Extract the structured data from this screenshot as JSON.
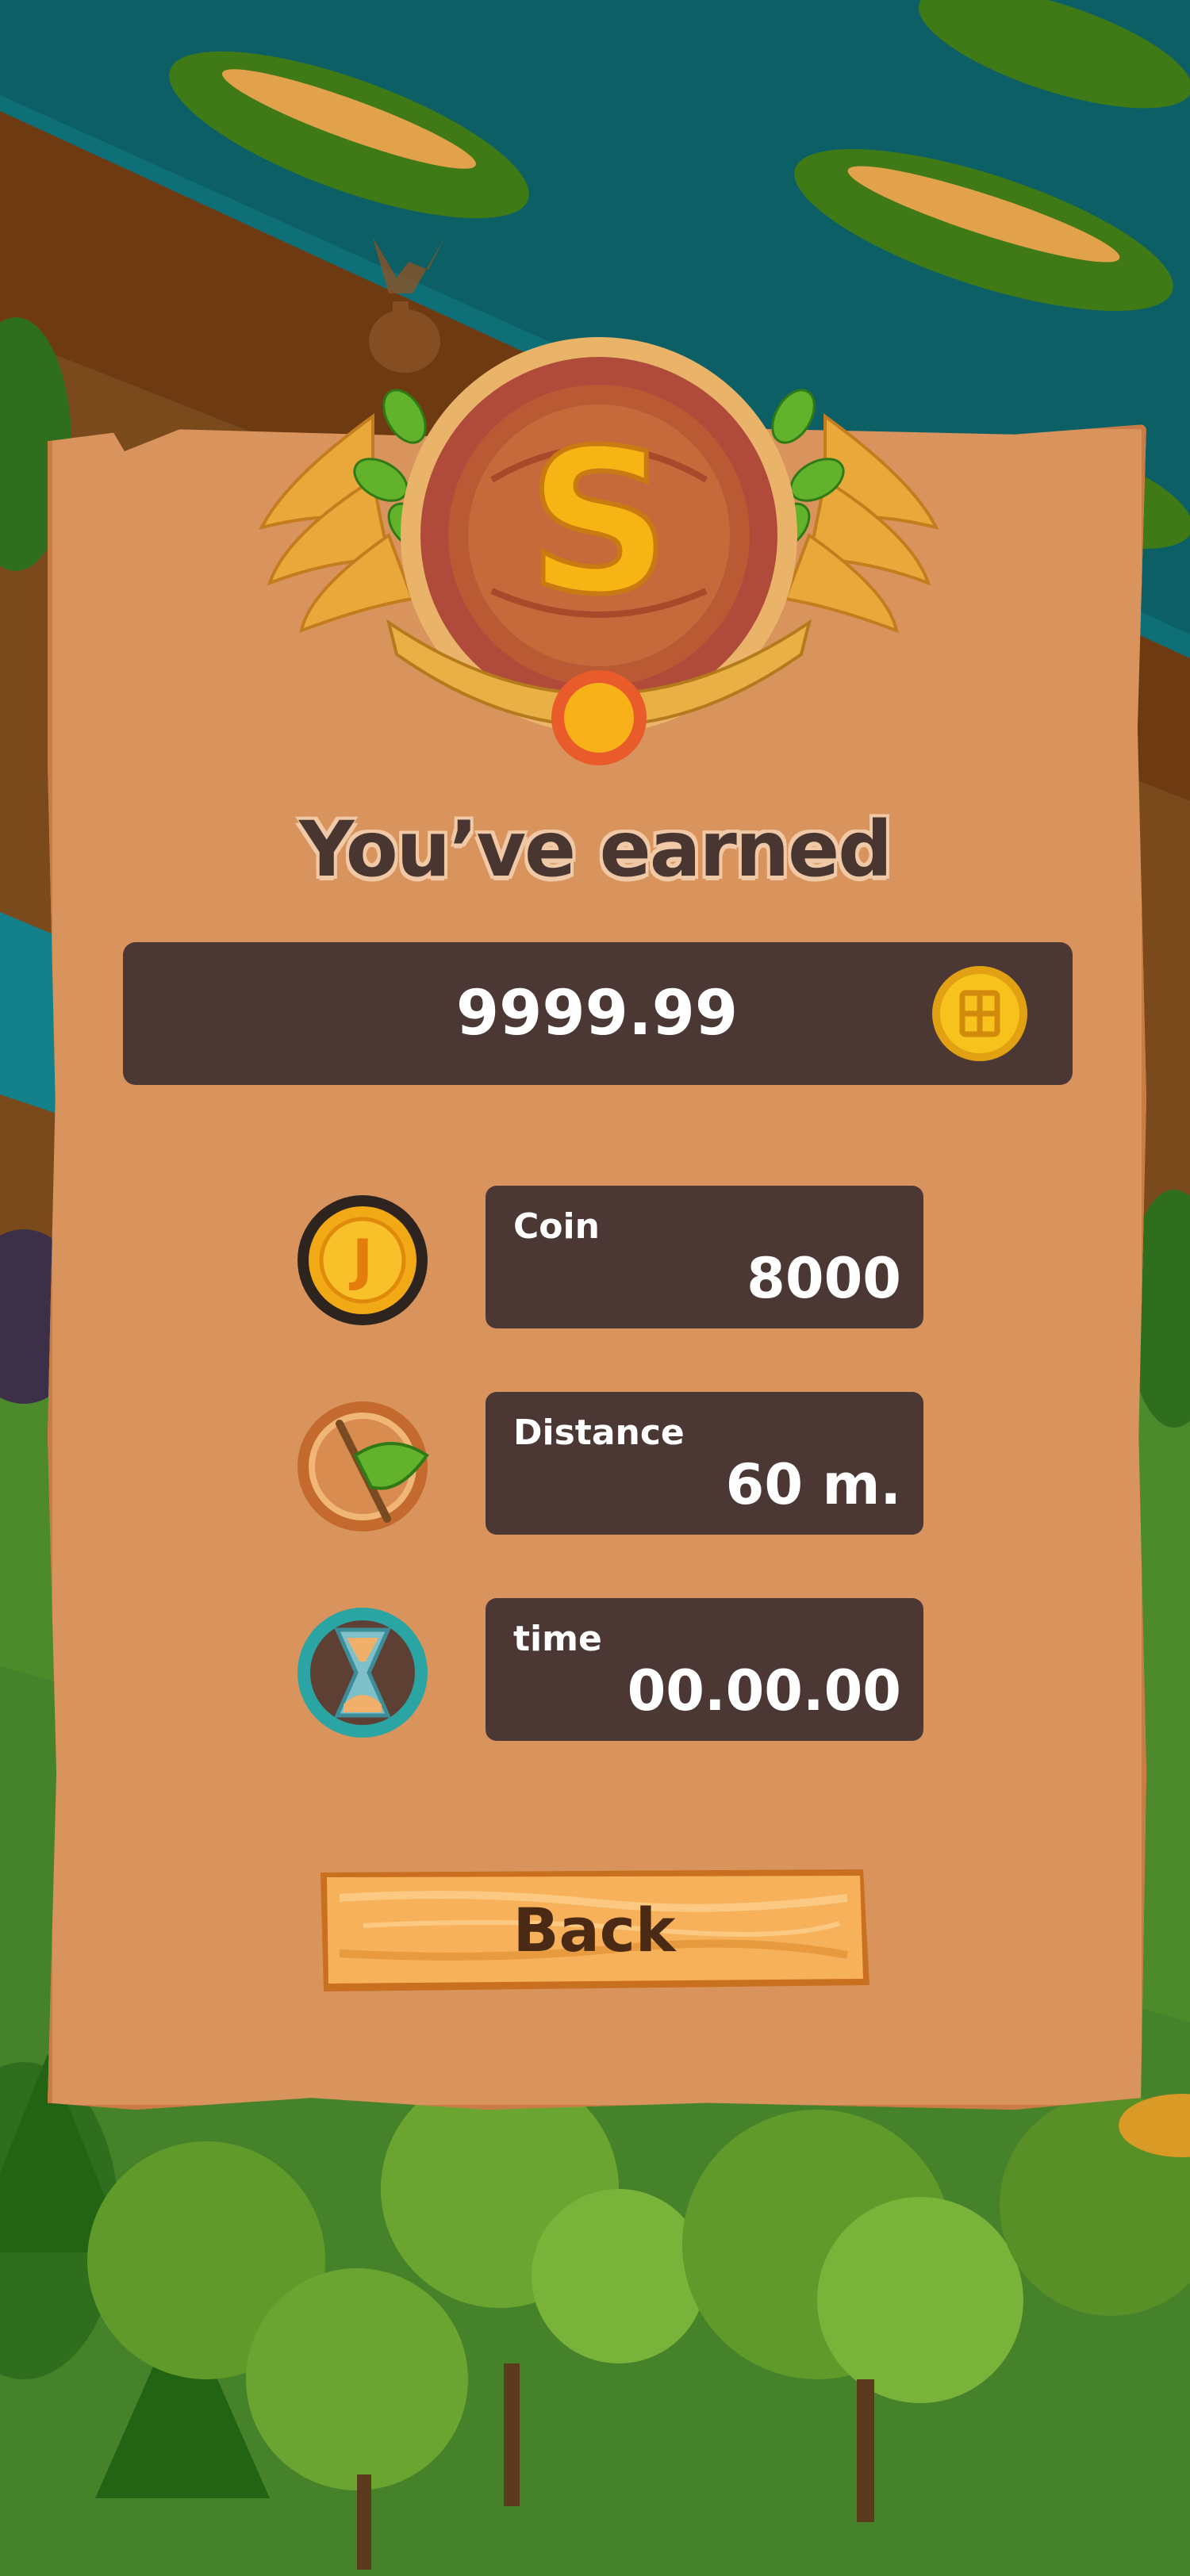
{
  "rank_badge": {
    "letter": "S"
  },
  "title": "You’ve earned",
  "earned": {
    "value": "9999.99",
    "icon": "gold-coin-icon"
  },
  "stats": [
    {
      "label": "Coin",
      "value": "8000",
      "icon": "coin-icon"
    },
    {
      "label": "Distance",
      "value": "60 m.",
      "icon": "flag-icon"
    },
    {
      "label": "time",
      "value": "00.00.00",
      "icon": "hourglass-icon"
    }
  ],
  "back_button": {
    "label": "Back"
  },
  "colors": {
    "panel": "#d9935c",
    "box": "#4b3834",
    "title_text": "#4a3630",
    "gold": "#f7b515",
    "wood": "#f6b15a"
  }
}
